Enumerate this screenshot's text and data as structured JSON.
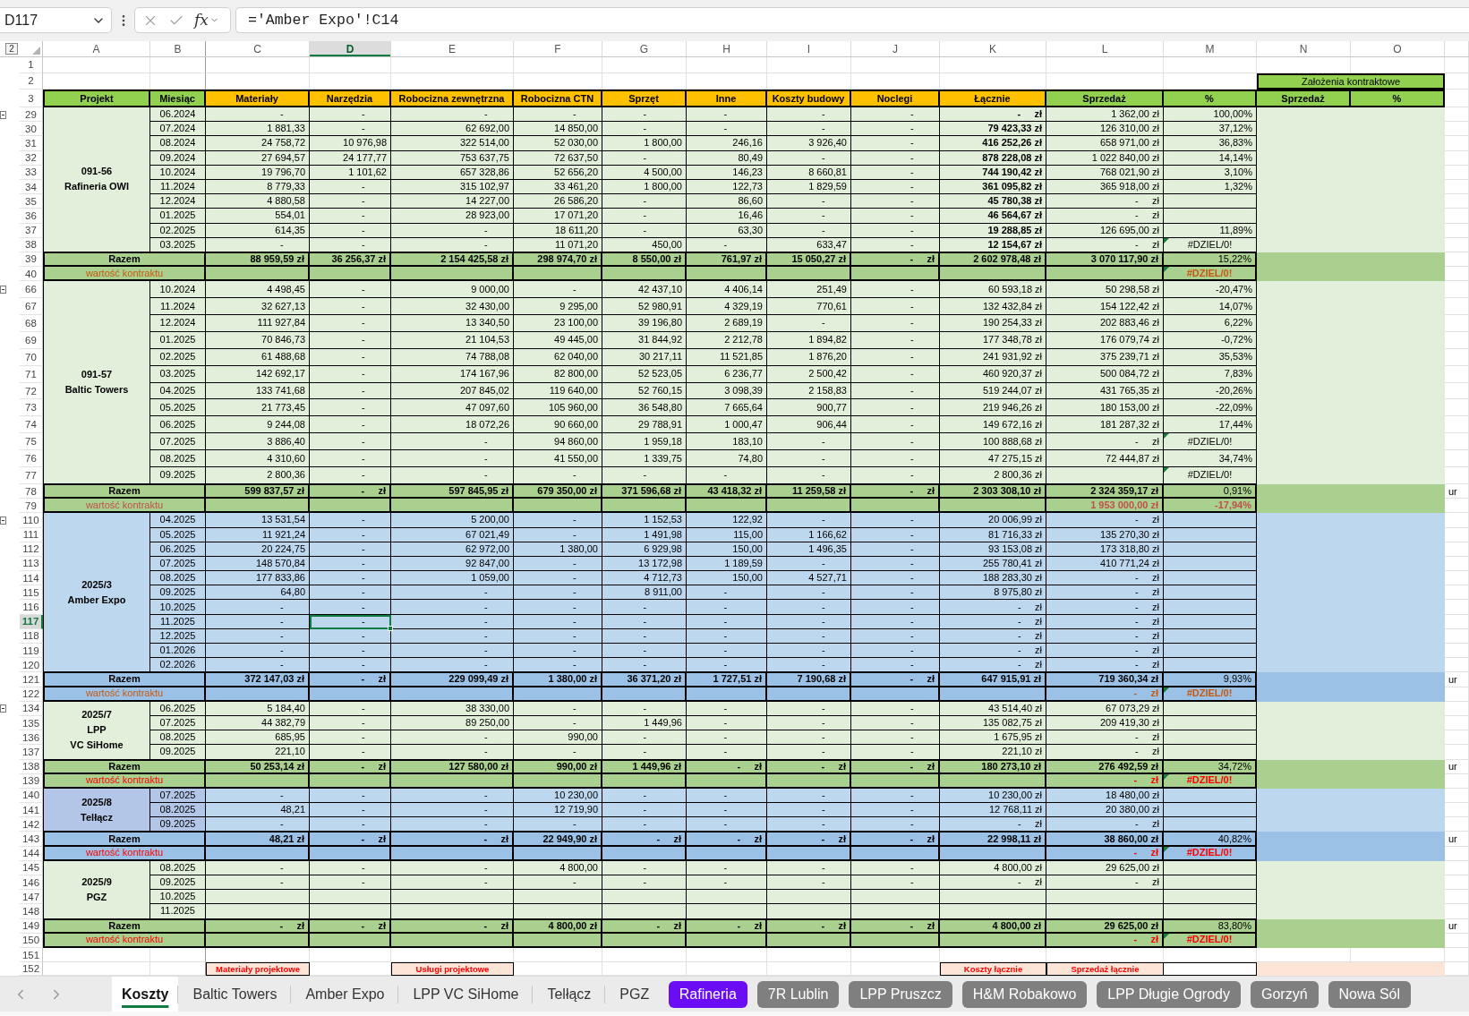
{
  "formula_bar": {
    "name_box": "D117",
    "function_label": "fx",
    "formula": "='Amber Expo'!C14"
  },
  "outline_level": "2",
  "columns": [
    {
      "label": "A",
      "selected": false
    },
    {
      "label": "B",
      "selected": false
    },
    {
      "label": "C",
      "selected": false
    },
    {
      "label": "D",
      "selected": true
    },
    {
      "label": "E",
      "selected": false
    },
    {
      "label": "F",
      "selected": false
    },
    {
      "label": "G",
      "selected": false
    },
    {
      "label": "H",
      "selected": false
    },
    {
      "label": "I",
      "selected": false
    },
    {
      "label": "J",
      "selected": false
    },
    {
      "label": "K",
      "selected": false
    },
    {
      "label": "L",
      "selected": false
    },
    {
      "label": "M",
      "selected": false
    },
    {
      "label": "N",
      "selected": false
    },
    {
      "label": "O",
      "selected": false
    }
  ],
  "top_rows": [
    {
      "row": "1",
      "selected": false
    },
    {
      "row": "2",
      "selected": false
    }
  ],
  "contract_heading": "Założenia kontraktowe",
  "header_row": {
    "row": "3",
    "selected": false,
    "cells": [
      {
        "label": "Projekt",
        "color": "#92d050"
      },
      {
        "label": "Miesiąc",
        "color": "#92d050"
      },
      {
        "label": "Materiały",
        "color": "#ffc000"
      },
      {
        "label": "Narzędzia",
        "color": "#ffc000"
      },
      {
        "label": "Robocizna zewnętrzna",
        "color": "#ffc000"
      },
      {
        "label": "Robocizna CTN",
        "color": "#ffc000"
      },
      {
        "label": "Sprzęt",
        "color": "#ffc000"
      },
      {
        "label": "Inne",
        "color": "#ffc000"
      },
      {
        "label": "Koszty budowy",
        "color": "#ffc000"
      },
      {
        "label": "Noclegi",
        "color": "#ffc000"
      },
      {
        "label": "Łącznie",
        "color": "#ffc000"
      },
      {
        "label": "Sprzedaż",
        "color": "#92d050"
      },
      {
        "label": "%",
        "color": "#92d050"
      },
      {
        "label": "Sprzedaż",
        "color": "#92d050"
      },
      {
        "label": "%",
        "color": "#92d050"
      }
    ]
  },
  "projects": [
    {
      "label": {
        "lines": [
          "091-56",
          "Rafineria OWI"
        ]
      },
      "color": "#e2efda",
      "outline_toggle": true,
      "bold_totals": true,
      "rows": [
        {
          "row": "29",
          "selected": false,
          "month": "06.2024",
          "cells": [
            "-        ",
            "-        ",
            "-        ",
            "-        ",
            "-             ",
            "-             ",
            "-        ",
            "-        ",
            "-     zł",
            "1 362,00 zł"
          ],
          "percent": {
            "text": "100,00%",
            "error": false
          }
        },
        {
          "row": "30",
          "selected": false,
          "month": "07.2024",
          "cells": [
            "1 881,33",
            "-        ",
            "62 692,00",
            "14 850,00",
            "-             ",
            "-             ",
            "-        ",
            "-        ",
            "79 423,33 zł",
            "126 310,00 zł"
          ],
          "percent": {
            "text": "37,12%",
            "error": false
          }
        },
        {
          "row": "31",
          "selected": false,
          "month": "08.2024",
          "cells": [
            "24 758,72",
            "10 976,98",
            "322 514,00",
            "52 030,00",
            "1 800,00",
            "246,16",
            "3 926,40",
            "-        ",
            "416 252,26 zł",
            "658 971,00 zł"
          ],
          "percent": {
            "text": "36,83%",
            "error": false
          }
        },
        {
          "row": "32",
          "selected": false,
          "month": "09.2024",
          "cells": [
            "27 694,57",
            "24 177,77",
            "753 637,75",
            "72 637,50",
            "-             ",
            "80,49",
            "-        ",
            "-        ",
            "878 228,08 zł",
            "1 022 840,00 zł"
          ],
          "percent": {
            "text": "14,14%",
            "error": false
          }
        },
        {
          "row": "33",
          "selected": false,
          "month": "10.2024",
          "cells": [
            "19 796,70",
            "1 101,62",
            "657 328,86",
            "52 656,20",
            "4 500,00",
            "146,23",
            "8 660,81",
            "-        ",
            "744 190,42 zł",
            "768 021,90 zł"
          ],
          "percent": {
            "text": "3,10%",
            "error": false
          }
        },
        {
          "row": "34",
          "selected": false,
          "month": "11.2024",
          "cells": [
            "8 779,33",
            "-        ",
            "315 102,97",
            "33 461,20",
            "1 800,00",
            "122,73",
            "1 829,59",
            "-        ",
            "361 095,82 zł",
            "365 918,00 zł"
          ],
          "percent": {
            "text": "1,32%",
            "error": false
          }
        },
        {
          "row": "35",
          "selected": false,
          "month": "12.2024",
          "cells": [
            "4 880,58",
            "-        ",
            "14 227,00",
            "26 586,20",
            "-             ",
            "86,60",
            "-        ",
            "-        ",
            "45 780,38 zł",
            "-     zł"
          ]
        },
        {
          "row": "36",
          "selected": false,
          "month": "01.2025",
          "cells": [
            "554,01",
            "-        ",
            "28 923,00",
            "17 071,20",
            "-             ",
            "16,46",
            "-        ",
            "-        ",
            "46 564,67 zł",
            "-     zł"
          ]
        },
        {
          "row": "37",
          "selected": false,
          "month": "02.2025",
          "cells": [
            "614,35",
            "-        ",
            "-        ",
            "18 611,20",
            "-             ",
            "63,30",
            "-        ",
            "-        ",
            "19 288,85 zł",
            "126 695,00 zł"
          ],
          "percent": {
            "text": "11,89%",
            "error": false
          }
        },
        {
          "row": "38",
          "selected": false,
          "month": "03.2025",
          "cells": [
            "-        ",
            "-        ",
            "-        ",
            "11 071,20",
            "450,00",
            "-             ",
            "633,47",
            "-        ",
            "12 154,67 zł",
            "-     zł"
          ],
          "percent": {
            "text": "#DZIEL/0!",
            "error": true
          }
        }
      ],
      "total": {
        "row": "39",
        "selected": false,
        "label": "Razem",
        "color": "#a9d08e",
        "cells": [
          "88 959,59 zł",
          "36 256,37 zł",
          "2 154 425,58 zł",
          "298 974,70 zł",
          "8 550,00 zł",
          "761,97 zł",
          "15 050,27 zł",
          "-     zł",
          "2 602 978,48 zł",
          "3 070 117,90 zł"
        ],
        "percent": {
          "text": "15,22%",
          "error": false
        }
      },
      "contract": {
        "row": "40",
        "selected": false,
        "label": "wartość kontraktu",
        "color": "#c65911",
        "percent": {
          "text": "#DZIEL/0!",
          "error": true
        }
      }
    },
    {
      "label": {
        "lines": [
          "091-57",
          "Baltic Towers"
        ]
      },
      "color": "#e2efda",
      "outline_toggle": true,
      "bold_totals": false,
      "rows": [
        {
          "row": "66",
          "selected": false,
          "month": "10.2024",
          "cells": [
            "4 498,45",
            "-        ",
            "9 000,00",
            "-        ",
            "42 437,10",
            "4 406,14",
            "251,49",
            "-        ",
            "60 593,18 zł",
            "50 298,58 zł"
          ],
          "percent": {
            "text": "-20,47%",
            "error": false
          }
        },
        {
          "row": "67",
          "selected": false,
          "month": "11.2024",
          "cells": [
            "32 627,13",
            "-        ",
            "32 430,00",
            "9 295,00",
            "52 980,91",
            "4 329,19",
            "770,61",
            "-        ",
            "132 432,84 zł",
            "154 122,42 zł"
          ],
          "percent": {
            "text": "14,07%",
            "error": false
          }
        },
        {
          "row": "68",
          "selected": false,
          "month": "12.2024",
          "cells": [
            "111 927,84",
            "-        ",
            "13 340,50",
            "23 100,00",
            "39 196,80",
            "2 689,19",
            "-        ",
            "-        ",
            "190 254,33 zł",
            "202 883,46 zł"
          ],
          "percent": {
            "text": "6,22%",
            "error": false
          }
        },
        {
          "row": "69",
          "selected": false,
          "month": "01.2025",
          "cells": [
            "70 846,73",
            "-        ",
            "21 104,53",
            "49 445,00",
            "31 844,92",
            "2 212,78",
            "1 894,82",
            "-        ",
            "177 348,78 zł",
            "176 079,74 zł"
          ],
          "percent": {
            "text": "-0,72%",
            "error": false
          }
        },
        {
          "row": "70",
          "selected": false,
          "month": "02.2025",
          "cells": [
            "61 488,68",
            "-        ",
            "74 788,08",
            "62 040,00",
            "30 217,11",
            "11 521,85",
            "1 876,20",
            "-        ",
            "241 931,92 zł",
            "375 239,71 zł"
          ],
          "percent": {
            "text": "35,53%",
            "error": false
          }
        },
        {
          "row": "71",
          "selected": false,
          "month": "03.2025",
          "cells": [
            "142 692,17",
            "-        ",
            "174 167,96",
            "82 800,00",
            "52 523,05",
            "6 236,77",
            "2 500,42",
            "-        ",
            "460 920,37 zł",
            "500 084,72 zł"
          ],
          "percent": {
            "text": "7,83%",
            "error": false
          }
        },
        {
          "row": "72",
          "selected": false,
          "month": "04.2025",
          "cells": [
            "133 741,68",
            "-        ",
            "207 845,02",
            "119 640,00",
            "52 760,15",
            "3 098,39",
            "2 158,83",
            "-        ",
            "519 244,07 zł",
            "431 765,35 zł"
          ],
          "percent": {
            "text": "-20,26%",
            "error": false
          }
        },
        {
          "row": "73",
          "selected": false,
          "month": "05.2025",
          "cells": [
            "21 773,45",
            "-        ",
            "47 097,60",
            "105 960,00",
            "36 548,80",
            "7 665,64",
            "900,77",
            "-        ",
            "219 946,26 zł",
            "180 153,00 zł"
          ],
          "percent": {
            "text": "-22,09%",
            "error": false
          }
        },
        {
          "row": "74",
          "selected": false,
          "month": "06.2025",
          "cells": [
            "9 244,08",
            "-        ",
            "18 072,26",
            "90 660,00",
            "29 788,91",
            "1 000,47",
            "906,44",
            "-        ",
            "149 672,16 zł",
            "181 287,32 zł"
          ],
          "percent": {
            "text": "17,44%",
            "error": false
          }
        },
        {
          "row": "75",
          "selected": false,
          "month": "07.2025",
          "cells": [
            "3 886,40",
            "-        ",
            "-        ",
            "94 860,00",
            "1 959,18",
            "183,10",
            "-        ",
            "-        ",
            "100 888,68 zł",
            "-     zł"
          ],
          "percent": {
            "text": "#DZIEL/0!",
            "error": true
          }
        },
        {
          "row": "76",
          "selected": false,
          "month": "08.2025",
          "cells": [
            "4 310,60",
            "-        ",
            "-        ",
            "41 550,00",
            "1 339,75",
            "74,80",
            "-        ",
            "-        ",
            "47 275,15 zł",
            "72 444,87 zł"
          ],
          "percent": {
            "text": "34,74%",
            "error": false
          }
        },
        {
          "row": "77",
          "selected": false,
          "month": "09.2025",
          "cells": [
            "2 800,36",
            "-        ",
            "-        ",
            "-        ",
            "-             ",
            "-             ",
            "-        ",
            "-        ",
            "2 800,36 zł",
            null
          ],
          "percent": {
            "text": "#DZIEL/0!",
            "error": true
          }
        }
      ],
      "total": {
        "row": "78",
        "selected": false,
        "label": "Razem",
        "color": "#a9d08e",
        "cells": [
          "599 837,57 zł",
          "-     zł",
          "597 845,95 zł",
          "679 350,00 zł",
          "371 596,68 zł",
          "43 418,32 zł",
          "11 259,58 zł",
          "-     zł",
          "2 303 308,10 zł",
          "2 324 359,17 zł"
        ],
        "percent": {
          "text": "0,91%",
          "error": false
        },
        "column_16": "ur"
      },
      "contract": {
        "row": "79",
        "selected": false,
        "label": "wartość kontraktu",
        "color": "#c0504d",
        "value": "1 953 000,00 zł",
        "percent": {
          "text": "-17,94%",
          "error": false
        }
      }
    },
    {
      "label": {
        "lines": [
          "2025/3",
          "Amber Expo"
        ]
      },
      "color": "#bdd7ee",
      "outline_toggle": true,
      "bold_totals": false,
      "rows": [
        {
          "row": "110",
          "selected": false,
          "month": "04.2025",
          "cells": [
            "13 531,54",
            "-        ",
            "5 200,00",
            "-        ",
            "1 152,53",
            "122,92",
            "-        ",
            "-        ",
            "20 006,99 zł",
            "-     zł"
          ]
        },
        {
          "row": "111",
          "selected": false,
          "month": "05.2025",
          "cells": [
            "11 921,24",
            "-        ",
            "67 021,49",
            "-        ",
            "1 491,98",
            "115,00",
            "1 166,62",
            "-        ",
            "81 716,33 zł",
            "135 270,30 zł"
          ]
        },
        {
          "row": "112",
          "selected": false,
          "month": "06.2025",
          "cells": [
            "20 224,75",
            "-        ",
            "62 972,00",
            "1 380,00",
            "6 929,98",
            "150,00",
            "1 496,35",
            "-        ",
            "93 153,08 zł",
            "173 318,80 zł"
          ]
        },
        {
          "row": "113",
          "selected": false,
          "month": "07.2025",
          "cells": [
            "148 570,84",
            "-        ",
            "92 847,00",
            "-        ",
            "13 172,98",
            "1 189,59",
            "-        ",
            "-        ",
            "255 780,41 zł",
            "410 771,24 zł"
          ]
        },
        {
          "row": "114",
          "selected": false,
          "month": "08.2025",
          "cells": [
            "177 833,86",
            "-        ",
            "1 059,00",
            "-        ",
            "4 712,73",
            "150,00",
            "4 527,71",
            "-        ",
            "188 283,30 zł",
            "-     zł"
          ]
        },
        {
          "row": "115",
          "selected": false,
          "month": "09.2025",
          "cells": [
            "64,80",
            "-        ",
            "-        ",
            "-        ",
            "8 911,00",
            "-             ",
            "-        ",
            "-        ",
            "8 975,80 zł",
            "-     zł"
          ]
        },
        {
          "row": "116",
          "selected": false,
          "month": "10.2025",
          "cells": [
            "-        ",
            "-        ",
            "-        ",
            "-        ",
            "-             ",
            "-             ",
            "-        ",
            "-        ",
            "-     zł",
            "-     zł"
          ]
        },
        {
          "row": "117",
          "selected": true,
          "month": "11.2025",
          "cells": [
            "-        ",
            "-        ",
            "-        ",
            "-        ",
            "-             ",
            "-             ",
            "-        ",
            "-        ",
            "-     zł",
            "-     zł"
          ]
        },
        {
          "row": "118",
          "selected": false,
          "month": "12.2025",
          "cells": [
            "-        ",
            "-        ",
            "-        ",
            "-        ",
            "-             ",
            "-             ",
            "-        ",
            "-        ",
            "-     zł",
            "-     zł"
          ]
        },
        {
          "row": "119",
          "selected": false,
          "month": "01.2026",
          "cells": [
            "-        ",
            "-        ",
            "-        ",
            "-        ",
            "-             ",
            "-             ",
            "-        ",
            "-        ",
            "-     zł",
            "-     zł"
          ]
        },
        {
          "row": "120",
          "selected": false,
          "month": "02.2026",
          "cells": [
            "-        ",
            "-        ",
            "-        ",
            "-        ",
            "-             ",
            "-             ",
            "-        ",
            "-        ",
            "-     zł",
            "-     zł"
          ]
        }
      ],
      "total": {
        "row": "121",
        "selected": false,
        "label": "Razem",
        "color": "#9bc2e6",
        "cells": [
          "372 147,03 zł",
          "-     zł",
          "229 099,49 zł",
          "1 380,00 zł",
          "36 371,20 zł",
          "1 727,51 zł",
          "7 190,68 zł",
          "-     zł",
          "647 915,91 zł",
          "719 360,34 zł"
        ],
        "percent": {
          "text": "9,93%",
          "error": false
        },
        "column_16": "ur"
      },
      "contract": {
        "row": "122",
        "selected": false,
        "label": "wartość kontraktu",
        "color": "#c65911",
        "value": "-     zł",
        "percent": {
          "text": "#DZIEL/0!",
          "error": true
        }
      }
    },
    {
      "label": {
        "lines": [
          "2025/7",
          "LPP",
          "VC SiHome"
        ]
      },
      "color": "#e2efda",
      "outline_toggle": true,
      "bold_totals": false,
      "rows": [
        {
          "row": "134",
          "selected": false,
          "month": "06.2025",
          "cells": [
            "5 184,40",
            "-        ",
            "38 330,00",
            "-        ",
            "-             ",
            "-             ",
            "-        ",
            "-        ",
            "43 514,40 zł",
            "67 073,29 zł"
          ]
        },
        {
          "row": "135",
          "selected": false,
          "month": "07.2025",
          "cells": [
            "44 382,79",
            "-        ",
            "89 250,00",
            "-        ",
            "1 449,96",
            "-             ",
            "-        ",
            "-        ",
            "135 082,75 zł",
            "209 419,30 zł"
          ]
        },
        {
          "row": "136",
          "selected": false,
          "month": "08.2025",
          "cells": [
            "685,95",
            "-        ",
            "-        ",
            "990,00",
            "-             ",
            "-             ",
            "-        ",
            "-        ",
            "1 675,95 zł",
            "-     zł"
          ]
        },
        {
          "row": "137",
          "selected": false,
          "month": "09.2025",
          "cells": [
            "221,10",
            "-        ",
            "-        ",
            "-        ",
            "-             ",
            "-             ",
            "-        ",
            "-        ",
            "221,10 zł",
            "-     zł"
          ]
        }
      ],
      "total": {
        "row": "138",
        "selected": false,
        "label": "Razem",
        "color": "#a9d08e",
        "cells": [
          "50 253,14 zł",
          "-     zł",
          "127 580,00 zł",
          "990,00 zł",
          "1 449,96 zł",
          "-     zł",
          "-     zł",
          "-     zł",
          "180 273,10 zł",
          "276 492,59 zł"
        ],
        "percent": {
          "text": "34,72%",
          "error": false
        },
        "column_16": "ur"
      },
      "contract": {
        "row": "139",
        "selected": false,
        "label": "wartość kontraktu",
        "color": "#ff0000",
        "value": "-     zł",
        "percent": {
          "text": "#DZIEL/0!",
          "error": true
        }
      }
    },
    {
      "label": {
        "lines": [
          "2025/8",
          "Telłącz"
        ],
        "color": "#b4c6e7"
      },
      "color": "#bdd7ee",
      "outline_toggle": false,
      "bold_totals": false,
      "rows": [
        {
          "row": "140",
          "selected": false,
          "month": "07.2025",
          "cells": [
            "-        ",
            "-        ",
            "-        ",
            "10 230,00",
            "-             ",
            "-             ",
            "-        ",
            "-        ",
            "10 230,00 zł",
            "18 480,00 zł"
          ]
        },
        {
          "row": "141",
          "selected": false,
          "month": "08.2025",
          "cells": [
            "48,21",
            "-        ",
            "-        ",
            "12 719,90",
            "-             ",
            "-             ",
            "-        ",
            "-        ",
            "12 768,11 zł",
            "20 380,00 zł"
          ]
        },
        {
          "row": "142",
          "selected": false,
          "month": "09.2025",
          "cells": [
            "-        ",
            "-        ",
            "-        ",
            "-        ",
            "-             ",
            "-             ",
            "-        ",
            "-        ",
            "-     zł",
            "-     zł"
          ]
        }
      ],
      "total": {
        "row": "143",
        "selected": false,
        "label": "Razem",
        "color": "#9bc2e6",
        "cells": [
          "48,21 zł",
          "-     zł",
          "-     zł",
          "22 949,90 zł",
          "-     zł",
          "-     zł",
          "-     zł",
          "-     zł",
          "22 998,11 zł",
          "38 860,00 zł"
        ],
        "percent": {
          "text": "40,82%",
          "error": false
        },
        "column_16": "ur"
      },
      "contract": {
        "row": "144",
        "selected": false,
        "label": "wartość kontraktu",
        "color": "#ff0000",
        "value": "-     zł",
        "percent": {
          "text": "#DZIEL/0!",
          "error": true
        }
      }
    },
    {
      "label": {
        "lines": [
          "2025/9",
          "PGZ"
        ]
      },
      "color": "#e2efda",
      "outline_toggle": false,
      "bold_totals": false,
      "rows": [
        {
          "row": "145",
          "selected": false,
          "month": "08.2025",
          "cells": [
            "-        ",
            "-        ",
            "-        ",
            "4 800,00",
            "-             ",
            "-             ",
            "-        ",
            "-        ",
            "4 800,00 zł",
            "29 625,00 zł"
          ]
        },
        {
          "row": "146",
          "selected": false,
          "month": "09.2025",
          "cells": [
            "-        ",
            "-        ",
            "-        ",
            "-        ",
            "-             ",
            "-             ",
            "-        ",
            "-        ",
            "-     zł",
            "-     zł"
          ]
        },
        {
          "row": "147",
          "selected": false,
          "month": "10.2025"
        },
        {
          "row": "148",
          "selected": false,
          "month": "11.2025"
        }
      ],
      "total": {
        "row": "149",
        "selected": false,
        "label": "Razem",
        "color": "#a9d08e",
        "cells": [
          "-     zł",
          "-     zł",
          "-     zł",
          "4 800,00 zł",
          "-     zł",
          "-     zł",
          "-     zł",
          "-     zł",
          "4 800,00 zł",
          "29 625,00 zł"
        ],
        "percent": {
          "text": "83,80%",
          "error": false
        },
        "column_16": "ur"
      },
      "contract": {
        "row": "150",
        "selected": false,
        "label": "wartość kontraktu",
        "color": "#ff0000",
        "value": "-     zł",
        "percent": {
          "text": "#DZIEL/0!",
          "error": true
        }
      }
    }
  ],
  "blank_row": {
    "row": "151",
    "selected": false
  },
  "summary_row": {
    "row": "152",
    "selected": false,
    "labels": [
      "Materiały projektowe",
      "Usługi projektowe",
      "Koszty łącznie",
      "Sprzedaż łącznie"
    ]
  },
  "sheet_tabs": [
    {
      "label": "Koszty",
      "selected": true
    },
    {
      "label": "Baltic Towers",
      "selected": false
    },
    {
      "label": "Amber Expo",
      "selected": false
    },
    {
      "label": "LPP VC SiHome",
      "selected": false
    },
    {
      "label": "Telłącz",
      "selected": false
    },
    {
      "label": "PGZ",
      "selected": false
    },
    {
      "label": "Rafineria",
      "selected": false,
      "color": "#6a0df5"
    },
    {
      "label": "7R Lublin",
      "selected": false,
      "color": "#7f7f7f"
    },
    {
      "label": "LPP Pruszcz",
      "selected": false,
      "color": "#7f7f7f"
    },
    {
      "label": "H&M Robakowo",
      "selected": false,
      "color": "#7f7f7f"
    },
    {
      "label": "LPP Długie Ogrody",
      "selected": false,
      "color": "#7f7f7f"
    },
    {
      "label": "Gorzyń",
      "selected": false,
      "color": "#7f7f7f"
    },
    {
      "label": "Nowa Sól",
      "selected": false,
      "color": "#7f7f7f"
    }
  ]
}
